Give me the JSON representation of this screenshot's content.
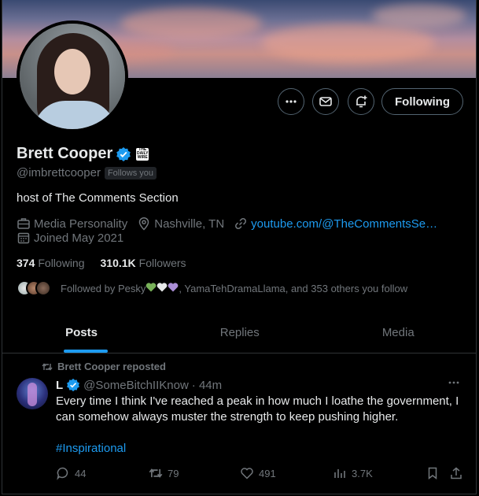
{
  "profile": {
    "name": "Brett Cooper",
    "affiliate_badge": "THE DAILY WIRE",
    "handle": "@imbrettcooper",
    "follows_you": "Follows you",
    "bio": "host of The Comments Section",
    "category": "Media Personality",
    "location": "Nashville, TN",
    "link": "youtube.com/@TheCommentsSe…",
    "joined": "Joined May 2021",
    "following_count": "374",
    "following_label": "Following",
    "followers_count": "310.1K",
    "followers_label": "Followers",
    "followed_by_prefix": "Followed by Pesky",
    "followed_by_suffix": ", YamaTehDramaLlama, and 353 others you follow"
  },
  "buttons": {
    "more": "more-icon",
    "message": "mail-icon",
    "notify": "bell-plus-icon",
    "following": "Following"
  },
  "tabs": [
    {
      "label": "Posts",
      "active": true
    },
    {
      "label": "Replies",
      "active": false
    },
    {
      "label": "Media",
      "active": false
    }
  ],
  "post": {
    "repost_label": "Brett Cooper reposted",
    "author_name": "L",
    "author_handle": "@SomeBitchIIKnow",
    "time": "· 44m",
    "text": "Every time I think I've reached a peak in how much I loathe the government, I can somehow always muster the strength to keep pushing higher.",
    "hashtag": "#Inspirational",
    "replies": "44",
    "reposts": "79",
    "likes": "491",
    "views": "3.7K"
  },
  "colors": {
    "accent": "#1d9bf0",
    "muted": "#71767b",
    "text": "#e7e9ea",
    "background": "#000000"
  }
}
